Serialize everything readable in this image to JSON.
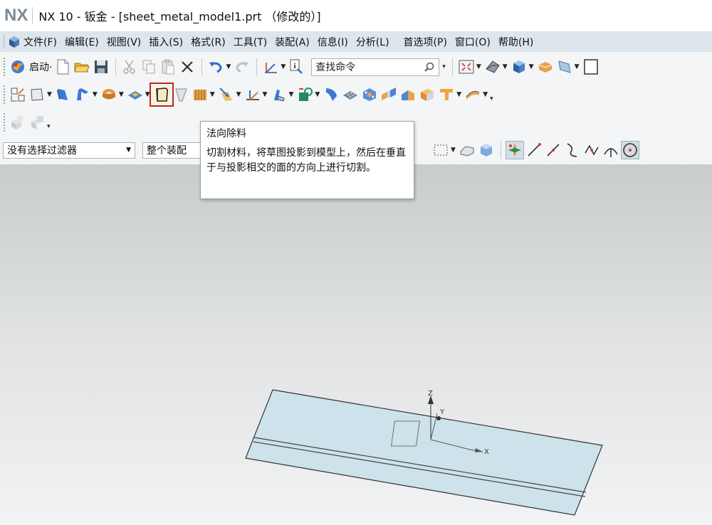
{
  "app": {
    "logo": "NX",
    "title": "NX 10 - 钣金 - [sheet_metal_model1.prt （修改的）]"
  },
  "menu": {
    "items": [
      "文件(F)",
      "编辑(E)",
      "视图(V)",
      "插入(S)",
      "格式(R)",
      "工具(T)",
      "装配(A)",
      "信息(I)",
      "分析(L)",
      "首选项(P)",
      "窗口(O)",
      "帮助(H)"
    ]
  },
  "toolbar": {
    "start_label": "启动·",
    "search_placeholder": "查找命令"
  },
  "selection": {
    "filter_value": "没有选择过滤器",
    "scope_value": "整个装配"
  },
  "tooltip": {
    "title": "法向除料",
    "description": "切割材料，将草图投影到模型上，然后在垂直于与投影相交的面的方向上进行切割。"
  },
  "viewport": {
    "axis_x": "X",
    "axis_y": "Y",
    "axis_z": "Z"
  },
  "colors": {
    "menubar_bg": "#dce6ec",
    "highlight": "#c0271d",
    "plate_fill": "#cde2ea"
  },
  "icons": [
    "start-icon",
    "new-icon",
    "open-icon",
    "save-icon",
    "cut-icon",
    "copy-icon",
    "paste-icon",
    "delete-icon",
    "undo-icon",
    "redo-icon",
    "measure-icon",
    "info-icon",
    "search-icon",
    "fit-icon",
    "view-icon",
    "normal-cutout-icon"
  ]
}
